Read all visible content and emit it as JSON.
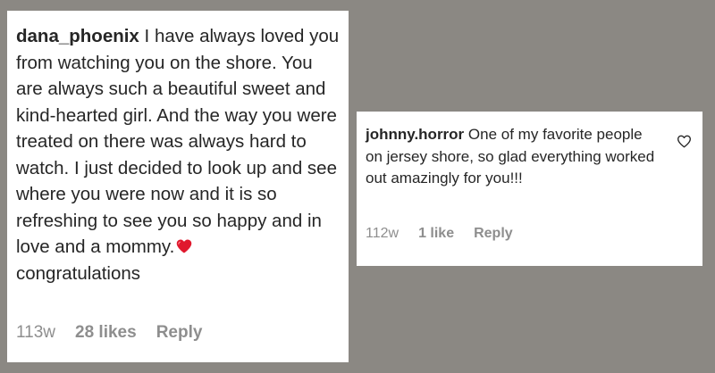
{
  "comments": [
    {
      "username": "dana_phoenix",
      "text": "I have always loved you from watching you on the shore. You are always such a beautiful sweet and kind-hearted girl. And the way you were treated on there was always hard to watch. I just decided to look up and see where you were now and it is so refreshing to see you so happy and in love and a mommy.",
      "text_after_emoji": "congratulations",
      "emoji": "red-heart",
      "time": "113w",
      "likes": "28 likes",
      "reply": "Reply"
    },
    {
      "username": "johnny.horror",
      "text": "One of my favorite people on jersey shore, so glad everything worked out amazingly for you!!!",
      "time": "112w",
      "likes": "1 like",
      "reply": "Reply",
      "icon": "heart-outline-icon"
    }
  ],
  "colors": {
    "background": "#8b8883",
    "card": "#ffffff",
    "text": "#262626",
    "meta": "#8e8e8e",
    "emoji_heart": "#e0182d"
  }
}
